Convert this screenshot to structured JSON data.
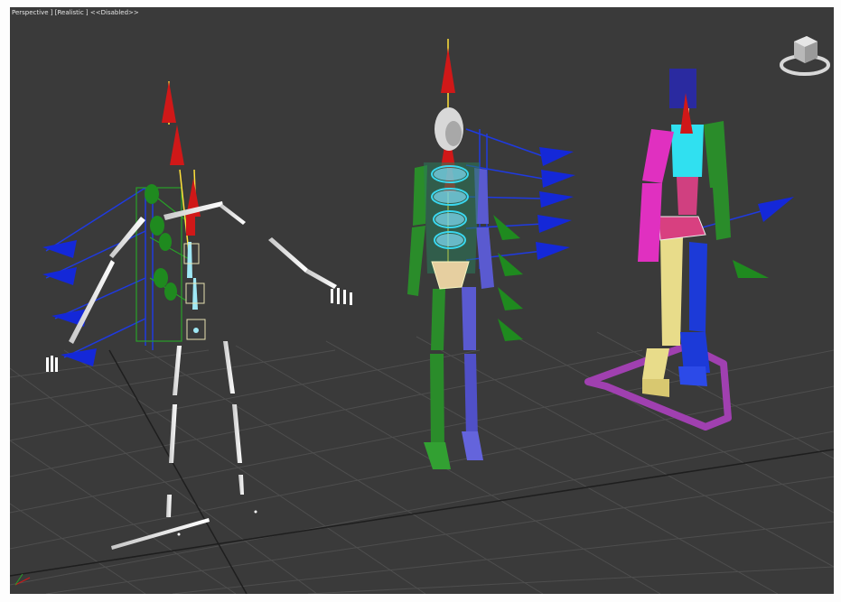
{
  "viewport": {
    "menu_perspective": "Perspective ]",
    "menu_shading": "[Realistic ]",
    "menu_state": "<<Disabled>>"
  },
  "colors": {
    "background": "#3a3a3a",
    "grid": "#4b4b4b",
    "axis_x": "#d01818",
    "axis_z_blue": "#1428d8",
    "gizmo_green": "#1f8a1f",
    "biped_left": "#2a8c2a",
    "biped_right": "#5a5ad0",
    "cat_magenta": "#e030c0",
    "cat_yellow": "#e8dc8a",
    "cat_cyan": "#30e0f0"
  },
  "icons": [
    "viewcube-icon",
    "axis-tripod-icon"
  ],
  "characters": [
    "bone-rig-figure",
    "biped-figure",
    "cat-rig-figure"
  ]
}
